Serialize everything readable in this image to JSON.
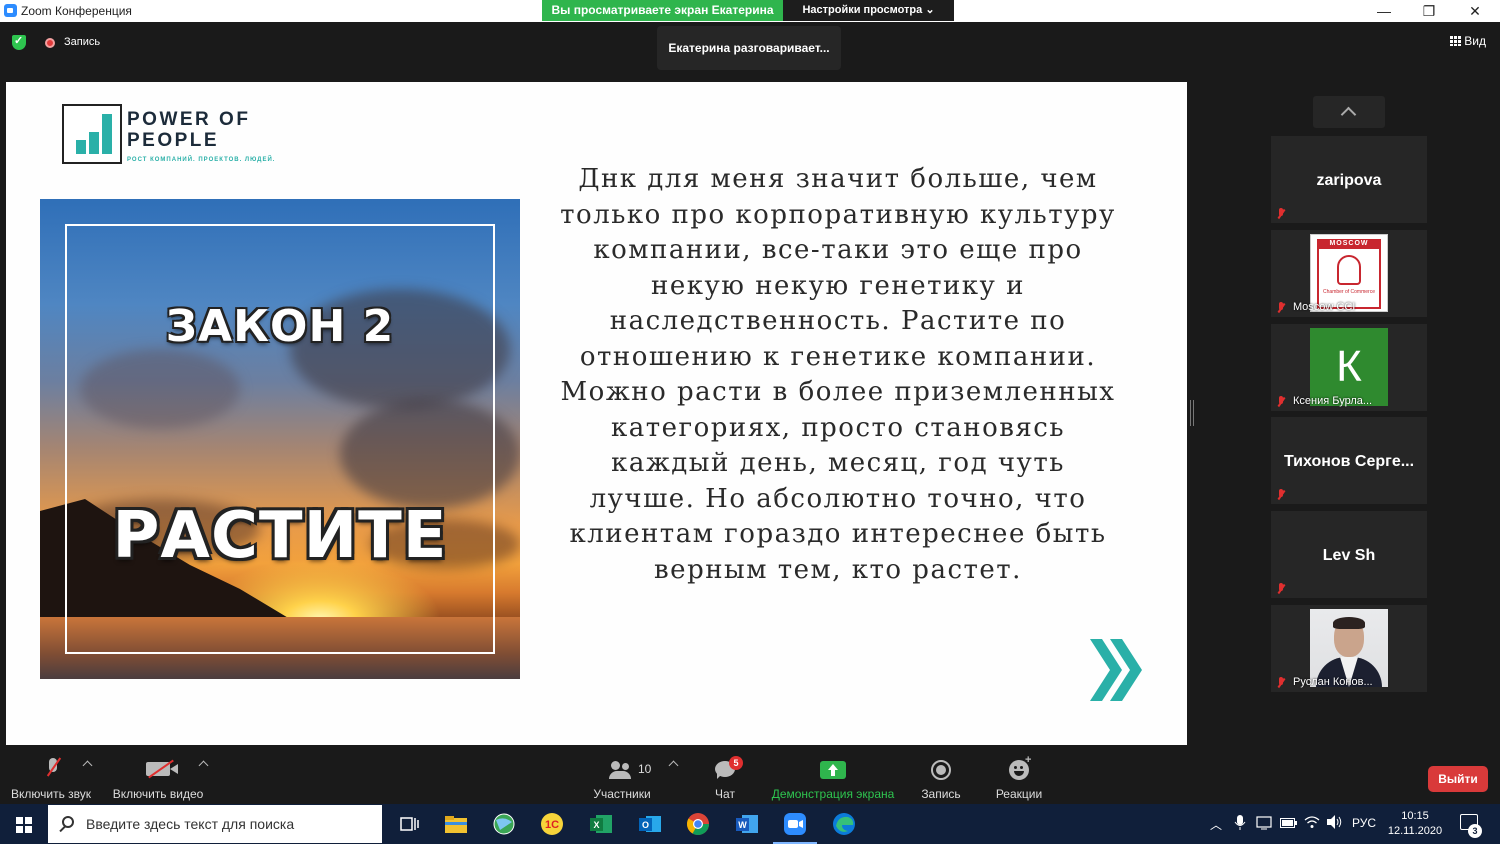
{
  "window": {
    "title": "Zoom Конференция",
    "share_banner": "Вы просматриваете экран Екатерина",
    "view_settings": "Настройки просмотра ⌄",
    "minimize": "—",
    "restore": "❐",
    "close": "✕"
  },
  "topbar": {
    "record_label": "Запись",
    "speaker_status": "Екатерина разговаривает...",
    "view_label": "Вид"
  },
  "slide": {
    "logo_title_line1": "POWER OF",
    "logo_title_line2": "PEOPLE",
    "logo_subtitle": "РОСТ КОМПАНИЙ. ПРОЕКТОВ. ЛЮДЕЙ.",
    "law_number": "ЗАКОН 2",
    "law_word": "РАСТИТЕ",
    "body_text": "Днк для меня значит больше, чем только про корпоративную культуру компании, все-таки это еще про некую некую генетику и наследственность. Растите по отношению к генетике компании. Можно расти в более приземленных категориях, просто становясь каждый день, месяц, год чуть лучше. Но абсолютно точно, что клиентам гораздо интереснее быть верным тем, кто растет.",
    "accent_color": "#2ab0a8"
  },
  "participants": [
    {
      "name": "zaripova",
      "label": "",
      "type": "name"
    },
    {
      "name": "",
      "label": "Moscow CCI",
      "type": "moscow",
      "pic_text": "MOSCOW",
      "pic_caption": "Chamber of Commerce"
    },
    {
      "name": "",
      "label": "Ксения Бурла...",
      "type": "letter",
      "letter": "К"
    },
    {
      "name": "Тихонов Серге...",
      "label": "",
      "type": "name"
    },
    {
      "name": "Lev Sh",
      "label": "",
      "type": "name"
    },
    {
      "name": "",
      "label": "Руслан Конов...",
      "type": "photo"
    }
  ],
  "toolbar": {
    "mute_label": "Включить звук",
    "video_label": "Включить видео",
    "participants_label": "Участники",
    "participants_count": "10",
    "chat_label": "Чат",
    "chat_badge": "5",
    "share_label": "Демонстрация экрана",
    "record_label": "Запись",
    "reactions_label": "Реакции",
    "leave_label": "Выйти"
  },
  "taskbar": {
    "search_placeholder": "Введите здесь текст для поиска",
    "lang": "РУС",
    "time": "10:15",
    "date": "12.11.2020",
    "notif_count": "3",
    "apps": [
      "task-view",
      "file-explorer",
      "browser-globe",
      "1c",
      "excel",
      "outlook",
      "chrome",
      "word",
      "zoom",
      "edge"
    ]
  }
}
